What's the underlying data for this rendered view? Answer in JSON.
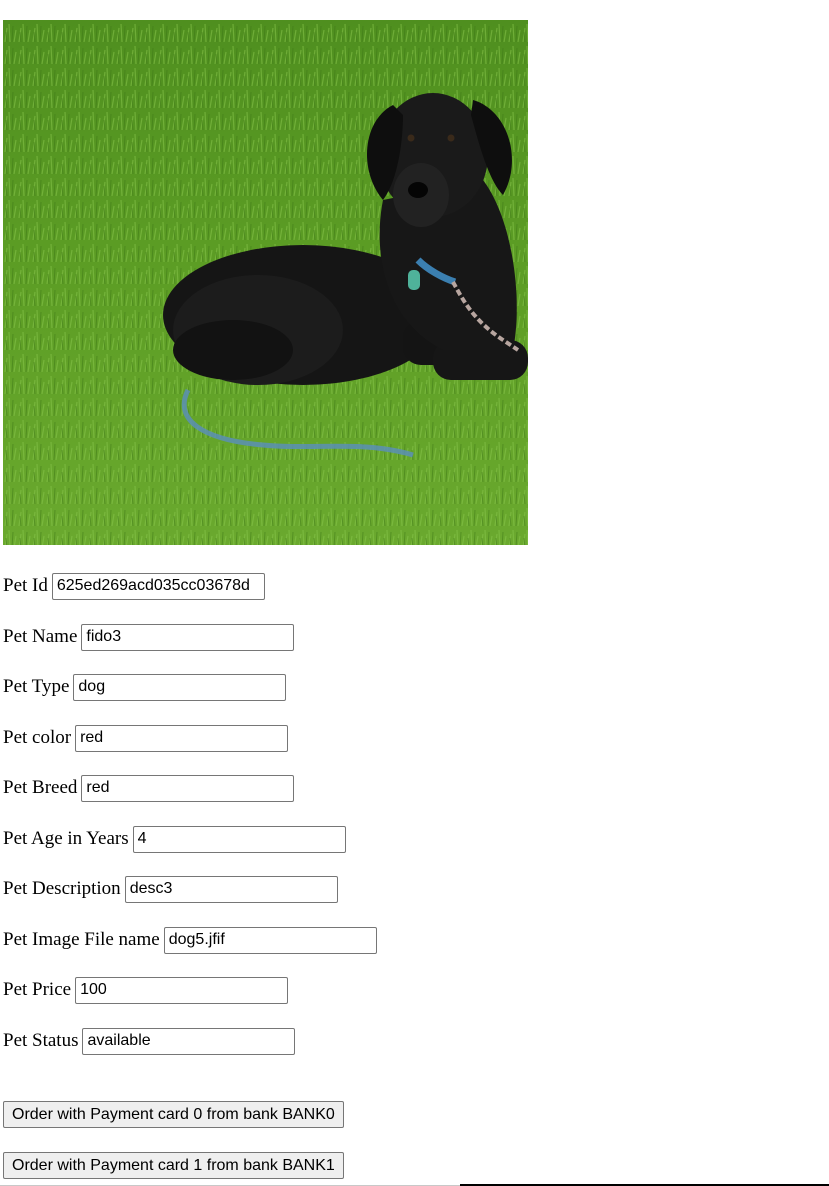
{
  "image": {
    "alt": "dog5.jfif"
  },
  "fields": [
    {
      "label": "Pet Id",
      "value": "625ed269acd035cc03678d"
    },
    {
      "label": "Pet Name",
      "value": "fido3"
    },
    {
      "label": "Pet Type",
      "value": "dog"
    },
    {
      "label": "Pet color",
      "value": "red"
    },
    {
      "label": "Pet Breed",
      "value": "red"
    },
    {
      "label": "Pet Age in Years",
      "value": "4"
    },
    {
      "label": "Pet Description",
      "value": "desc3"
    },
    {
      "label": "Pet Image File name",
      "value": "dog5.jfif"
    },
    {
      "label": "Pet Price",
      "value": "100"
    },
    {
      "label": "Pet Status",
      "value": "available"
    }
  ],
  "buttons": {
    "order0": "Order with Payment card 0 from bank BANK0",
    "order1": "Order with Payment card 1 from bank BANK1"
  }
}
